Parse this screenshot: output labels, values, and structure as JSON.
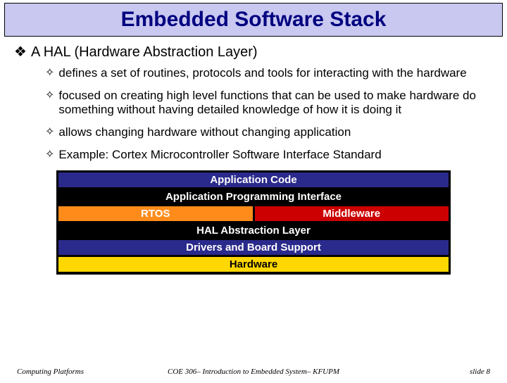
{
  "title": "Embedded Software Stack",
  "main_bullet": "A HAL (Hardware Abstraction Layer)",
  "sub_bullets": [
    "defines a set of routines, protocols and tools for interacting with the hardware",
    "focused on creating high level functions that can be used to make hardware do something without having detailed knowledge of how it is doing it",
    "allows changing hardware without changing application",
    "Example: Cortex Microcontroller Software Interface Standard"
  ],
  "stack": {
    "app": "Application Code",
    "api": "Application Programming Interface",
    "rtos": "RTOS",
    "mw": "Middleware",
    "hal": "HAL Abstraction Layer",
    "drv": "Drivers and Board Support",
    "hw": "Hardware"
  },
  "footer": {
    "left": "Computing Platforms",
    "mid": "COE 306– Introduction to Embedded System– KFUPM",
    "right": "slide 8"
  }
}
